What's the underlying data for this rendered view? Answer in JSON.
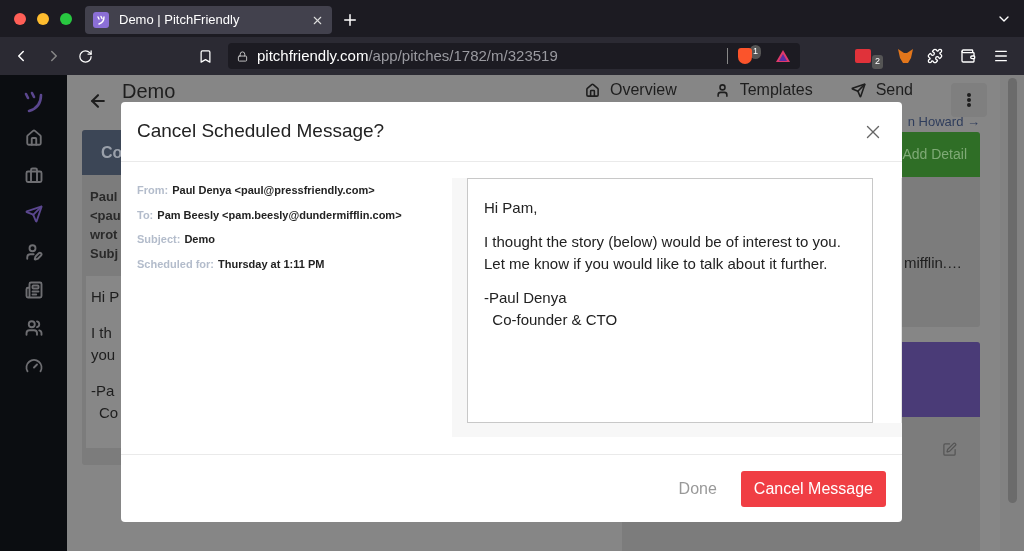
{
  "browser": {
    "tab_title": "Demo | PitchFriendly",
    "url_host": "pitchfriendly.com",
    "url_path": "/app/pitches/1782/m/323519",
    "shield_count": "1",
    "extension_count": "2"
  },
  "sidebar": {
    "items": [
      {
        "selected": false
      },
      {
        "selected": false
      },
      {
        "selected": true
      },
      {
        "selected": false
      },
      {
        "selected": false
      },
      {
        "selected": false
      },
      {
        "selected": false
      }
    ]
  },
  "page": {
    "title": "Demo",
    "nav": [
      {
        "label": "Overview"
      },
      {
        "label": "Templates"
      },
      {
        "label": "Send"
      }
    ],
    "card_header": "Co",
    "card_meta": [
      "Paul",
      "<pau",
      "wrot",
      "Subj"
    ],
    "card_body": [
      [
        "Hi P"
      ],
      [
        "I th",
        "you"
      ],
      [
        "-Pa",
        "Co"
      ]
    ],
    "contact_link": "n Howard →",
    "add_detail": "Add Detail",
    "detail_value": "mifflin.…"
  },
  "modal": {
    "title": "Cancel Scheduled Message?",
    "fields": [
      {
        "label": "From:",
        "value": "Paul Denya <paul@pressfriendly.com>"
      },
      {
        "label": "To:",
        "value": "Pam Beesly <pam.beesly@dundermifflin.com>"
      },
      {
        "label": "Subject:",
        "value": "Demo"
      },
      {
        "label": "Scheduled for:",
        "value": "Thursday at 1:11 PM"
      }
    ],
    "message": [
      [
        "Hi Pam,"
      ],
      [
        "I thought the story (below) would be of interest to you. Let me know if you would like to talk about it further."
      ],
      [
        "-Paul Denya",
        "  Co-founder & CTO"
      ]
    ],
    "done_button": "Done",
    "cancel_button": "Cancel Message"
  }
}
